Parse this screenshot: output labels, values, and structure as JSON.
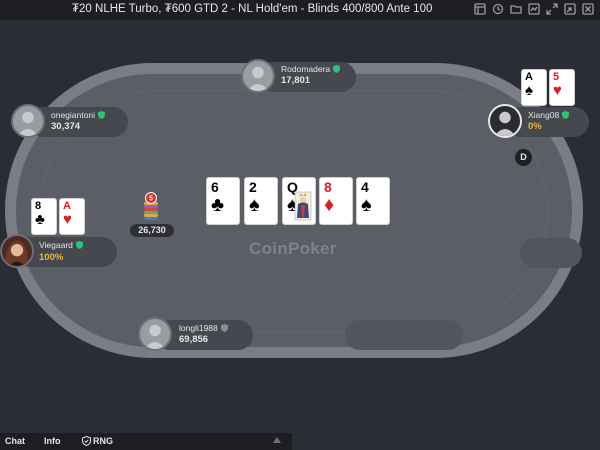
{
  "window": {
    "title": "₮20 NLHE Turbo, ₮600 GTD 2 - NL Hold'em - Blinds 400/800 Ante 100",
    "icons": [
      "grid-icon",
      "history-icon",
      "folder-icon",
      "chart-icon",
      "expand-icon",
      "shrink-icon",
      "close-icon"
    ]
  },
  "table": {
    "logo": "CoinPoker",
    "pot": "26,730",
    "chip_stack_top": "5",
    "dealer_label": "D"
  },
  "board": [
    {
      "rank": "6",
      "suit": "♣",
      "color": "black"
    },
    {
      "rank": "2",
      "suit": "♠",
      "color": "black"
    },
    {
      "rank": "Q",
      "suit": "♠",
      "color": "black"
    },
    {
      "rank": "8",
      "suit": "♦",
      "color": "red"
    },
    {
      "rank": "4",
      "suit": "♠",
      "color": "black"
    }
  ],
  "players": {
    "top": {
      "name": "Rodomadera",
      "stack": "17,801"
    },
    "upper_left": {
      "name": "onegiantoni",
      "stack": "30,374"
    },
    "right": {
      "name": "Xiang08",
      "stack": "0%",
      "cards": [
        {
          "rank": "A",
          "suit": "♠",
          "color": "black"
        },
        {
          "rank": "5",
          "suit": "♥",
          "color": "red"
        }
      ]
    },
    "left": {
      "name": "Viegaard",
      "stack": "100%",
      "cards": [
        {
          "rank": "8",
          "suit": "♣",
          "color": "black"
        },
        {
          "rank": "A",
          "suit": "♥",
          "color": "red"
        }
      ]
    },
    "bottom": {
      "name": "longli1988",
      "stack": "69,856"
    }
  },
  "bottom_bar": {
    "chat": "Chat",
    "info": "Info",
    "rng": "RNG"
  },
  "colors": {
    "accent_gold": "#f2b732",
    "verified_green": "#2fc07a",
    "felt": "#5b5e65",
    "rail": "#7a7d83"
  }
}
